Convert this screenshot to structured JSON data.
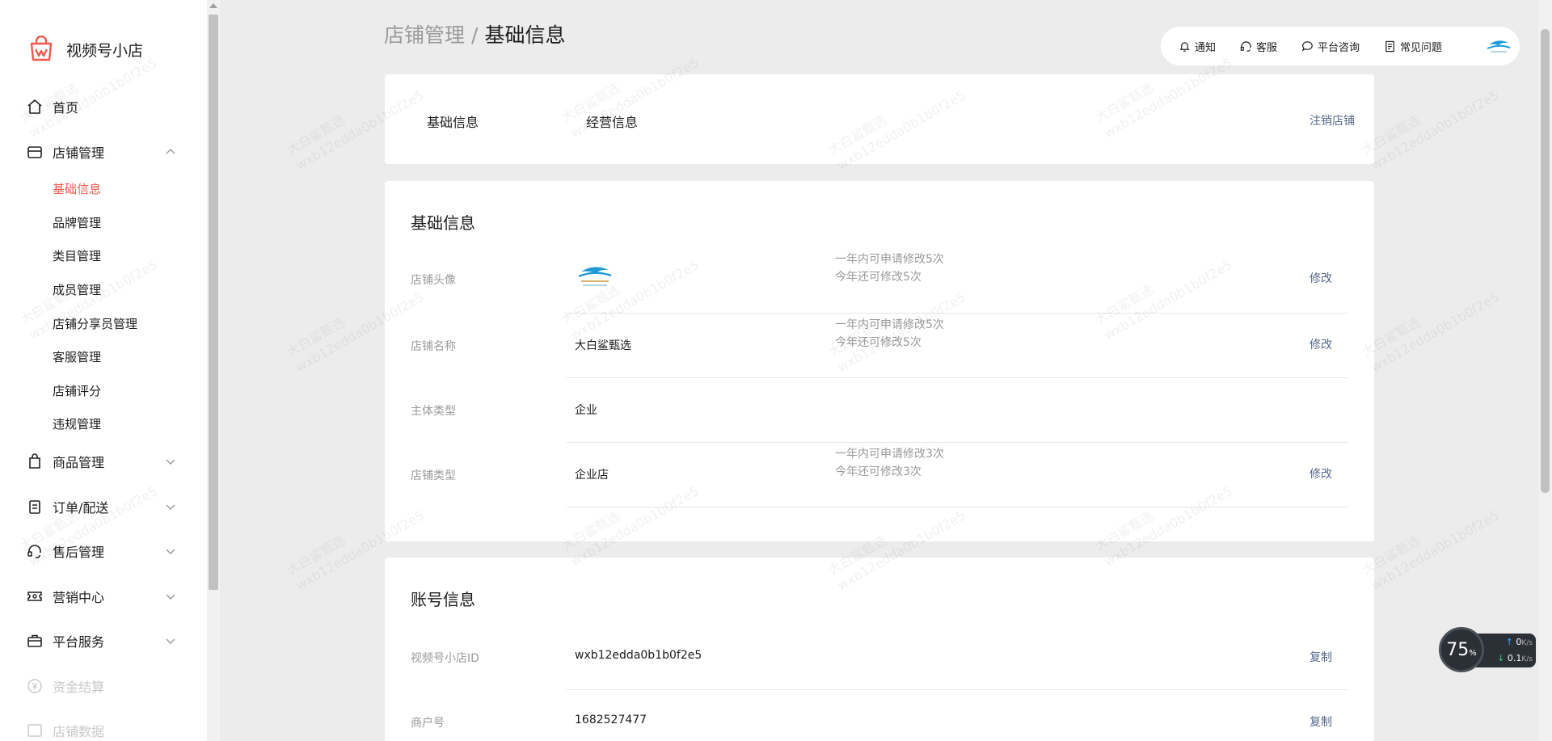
{
  "app": {
    "name": "视频号小店"
  },
  "sidebar": {
    "items": [
      {
        "label": "首页",
        "icon": "home-icon"
      },
      {
        "label": "店铺管理",
        "icon": "store-icon",
        "expanded": true
      },
      {
        "label": "商品管理",
        "icon": "bag-icon"
      },
      {
        "label": "订单/配送",
        "icon": "clipboard-icon"
      },
      {
        "label": "售后管理",
        "icon": "headset-icon"
      },
      {
        "label": "营销中心",
        "icon": "ticket-icon"
      },
      {
        "label": "平台服务",
        "icon": "briefcase-icon"
      },
      {
        "label": "资金结算",
        "icon": "yen-icon"
      },
      {
        "label": "店铺数据",
        "icon": "image-icon"
      }
    ],
    "subitems": [
      {
        "label": "基础信息",
        "active": true
      },
      {
        "label": "品牌管理"
      },
      {
        "label": "类目管理"
      },
      {
        "label": "成员管理"
      },
      {
        "label": "店铺分享员管理"
      },
      {
        "label": "客服管理"
      },
      {
        "label": "店铺评分"
      },
      {
        "label": "违规管理"
      }
    ]
  },
  "breadcrumb": {
    "parent": "店铺管理",
    "separator": "/",
    "current": "基础信息"
  },
  "topbar": {
    "notify": "通知",
    "service": "客服",
    "consult": "平台咨询",
    "faq": "常见问题"
  },
  "tabs": {
    "basic": "基础信息",
    "business": "经营信息",
    "deregister": "注销店铺"
  },
  "basic_info": {
    "title": "基础信息",
    "rows": [
      {
        "key": "店铺头像",
        "value": "",
        "note1": "一年内可申请修改5次",
        "note2": "今年还可修改5次",
        "action": "修改"
      },
      {
        "key": "店铺名称",
        "value": "大白鲨甄选",
        "note1": "一年内可申请修改5次",
        "note2": "今年还可修改5次",
        "action": "修改"
      },
      {
        "key": "主体类型",
        "value": "企业",
        "note1": "",
        "note2": "",
        "action": ""
      },
      {
        "key": "店铺类型",
        "value": "企业店",
        "note1": "一年内可申请修改3次",
        "note2": "今年还可修改3次",
        "action": "修改"
      }
    ]
  },
  "account_info": {
    "title": "账号信息",
    "rows": [
      {
        "key": "视频号小店ID",
        "value": "wxb12edda0b1b0f2e5",
        "action": "复制"
      },
      {
        "key": "商户号",
        "value": "1682527477",
        "action": "复制"
      }
    ]
  },
  "network_widget": {
    "percent": "75",
    "percent_unit": "%",
    "up": "0",
    "up_unit": "K/s",
    "down": "0.1",
    "down_unit": "K/s"
  },
  "watermark": {
    "line1": "大白鲨甄选",
    "line2": "wxb12edda0b1b0f2e5"
  },
  "colors": {
    "accent": "#f2584b",
    "link": "#55688a",
    "background": "#ececec"
  }
}
